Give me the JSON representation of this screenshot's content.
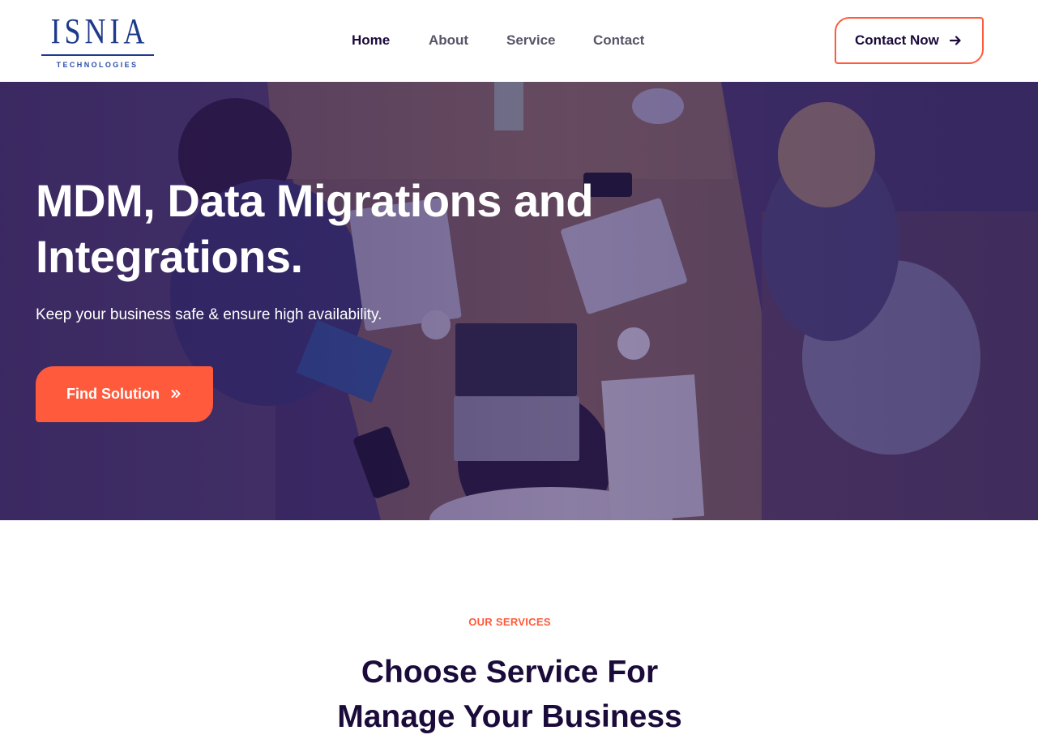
{
  "brand": {
    "logo_word": "ISNIA",
    "logo_sub": "TECHNOLOGIES",
    "accent": "#ff5a3c",
    "dark": "#1b0b3b",
    "logo_blue": "#1e3a8a"
  },
  "nav": {
    "items": [
      {
        "label": "Home",
        "active": true
      },
      {
        "label": "About",
        "active": false
      },
      {
        "label": "Service",
        "active": false
      },
      {
        "label": "Contact",
        "active": false
      }
    ],
    "cta_label": "Contact Now",
    "cta_icon": "arrow-right-icon"
  },
  "hero": {
    "title_line1": "MDM, Data Migrations and",
    "title_line2": "Integrations.",
    "subtitle": "Keep your business safe & ensure high availability.",
    "button_label": "Find Solution",
    "button_icon": "double-chevron-right-icon"
  },
  "services": {
    "eyebrow": "OUR SERVICES",
    "title_line1": "Choose Service For",
    "title_line2": "Manage Your Business"
  }
}
